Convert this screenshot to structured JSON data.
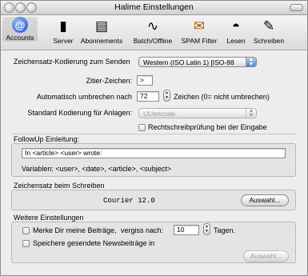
{
  "window": {
    "title": "Halime Einstellungen"
  },
  "toolbar": [
    {
      "label": "Accounts",
      "icon": "at-sign-icon",
      "glyph": "@"
    },
    {
      "label": "Server",
      "icon": "server-icon",
      "glyph": "▮"
    },
    {
      "label": "Abonnements",
      "icon": "newspaper-icon",
      "glyph": "▤"
    },
    {
      "label": "Batch/Offline",
      "icon": "wave-icon",
      "glyph": "∿"
    },
    {
      "label": "SPAM Filter",
      "icon": "spam-filter-icon",
      "glyph": "✉"
    },
    {
      "label": "Lesen",
      "icon": "glasses-icon",
      "glyph": "◓"
    },
    {
      "label": "Schreiben",
      "icon": "pen-icon",
      "glyph": "✎"
    }
  ],
  "send_encoding": {
    "label": "Zeichensatz-Kodierung zum Senden",
    "value": "Western (ISO Latin 1) [ISO-88"
  },
  "quote_char": {
    "label": "Zitier-Zeichen:",
    "value": ">"
  },
  "wrap": {
    "label": "Automatisch umbrechen nach",
    "value": "72",
    "suffix": "Zeichen (0= nicht umbrechen)"
  },
  "attachment_encoding": {
    "label": "Standard Kodierung für Anlagen:",
    "value": "UUencode"
  },
  "spellcheck": {
    "label": "Rechtschreibprüfung bei der Eingabe"
  },
  "followup": {
    "title": "FollowUp Einleitung:",
    "value": "In <article> <user> wrote:",
    "variables": "Variablen: <user>, <date>, <article>, <subject>"
  },
  "charset": {
    "title": "Zeichensatz beim Schreiben",
    "font": "Courier 12.0",
    "button": "Auswahl..."
  },
  "further": {
    "title": "Weitere Einstellungen",
    "remember_label": "Merke Dir meine Beiträge,",
    "forget_label": "vergiss nach:",
    "days_value": "10",
    "days_suffix": "Tagen.",
    "save_label": "Speichere gesendete Newsbeiträge in",
    "button": "Auswahl..."
  }
}
